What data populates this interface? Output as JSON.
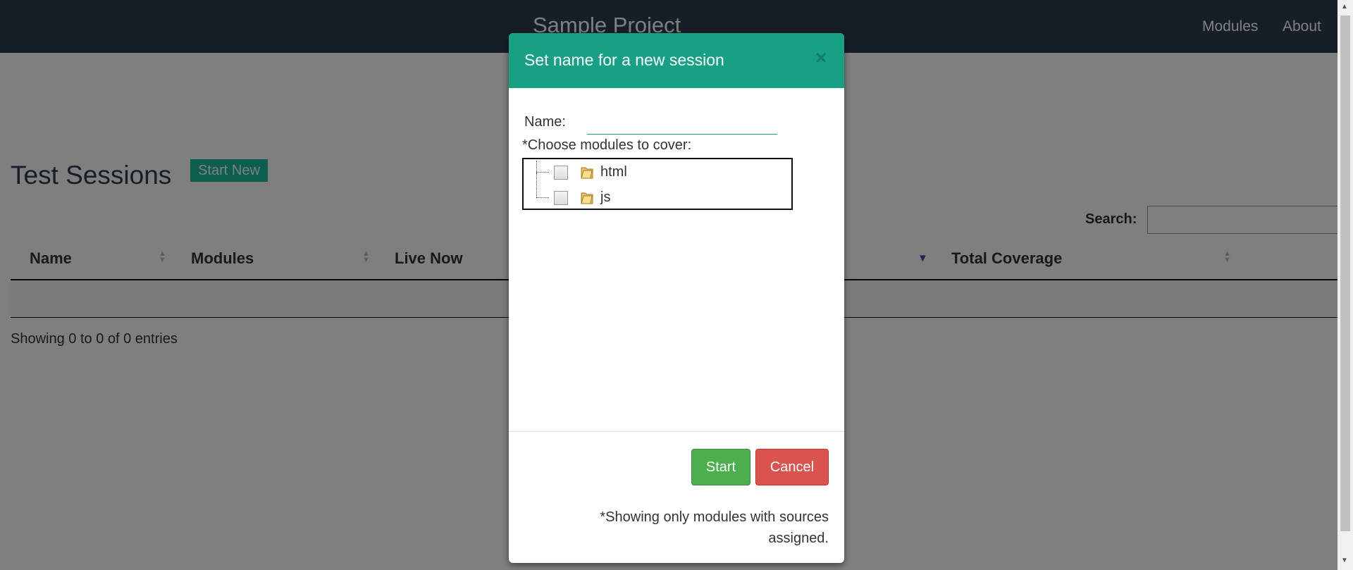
{
  "navbar": {
    "brand": "Sample Project",
    "links": [
      "Modules",
      "About"
    ]
  },
  "page": {
    "title": "Test Sessions",
    "start_new_label": "Start New",
    "search_label": "Search:",
    "search_value": "",
    "columns": [
      "Name",
      "Modules",
      "Live Now",
      "Total Coverage"
    ],
    "info": "Showing 0 to 0 of 0 entries"
  },
  "modal": {
    "title": "Set name for a new session",
    "close_glyph": "×",
    "name_label": "Name:",
    "name_value": "",
    "choose_label": "*Choose modules to cover:",
    "modules": [
      {
        "label": "html",
        "checked": false,
        "icon": "folder-icon"
      },
      {
        "label": "js",
        "checked": false,
        "icon": "folder-icon"
      }
    ],
    "start_label": "Start",
    "cancel_label": "Cancel",
    "footnote": "*Showing only modules with sources assigned."
  },
  "colors": {
    "navbar": "#2c3e50",
    "modal_header": "#18a085",
    "start_new": "#18bc9c",
    "start_button": "#4cae4c",
    "cancel_button": "#d9534f"
  }
}
